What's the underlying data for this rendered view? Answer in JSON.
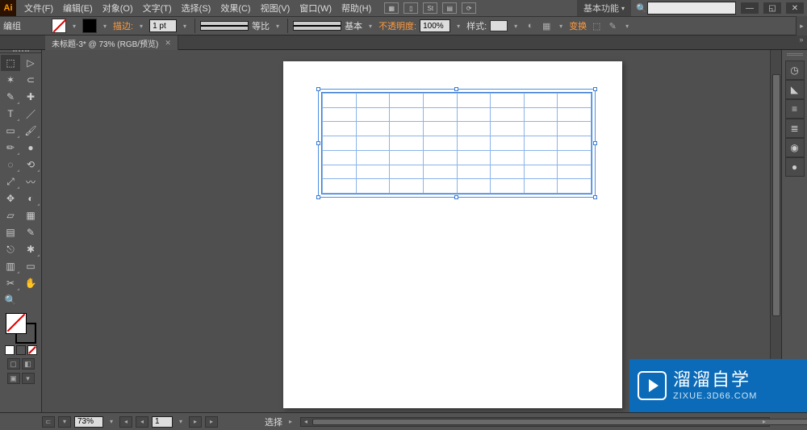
{
  "menubar": {
    "items": [
      "文件(F)",
      "编辑(E)",
      "对象(O)",
      "文字(T)",
      "选择(S)",
      "效果(C)",
      "视图(V)",
      "窗口(W)",
      "帮助(H)"
    ],
    "workspace_label": "基本功能",
    "search_placeholder": ""
  },
  "controlbar": {
    "context_label": "编组",
    "stroke_label": "描边:",
    "stroke_value": "1 pt",
    "dash_profile_label": "等比",
    "brush_label": "基本",
    "opacity_label": "不透明度:",
    "opacity_value": "100%",
    "style_label": "样式:",
    "transform_label": "变换"
  },
  "tabs": {
    "tab_title": "未标题-3* @ 73% (RGB/预览)"
  },
  "statusbar": {
    "zoom_value": "73%",
    "page_value": "1",
    "mode_label": "选择"
  },
  "tools": [
    [
      "selection",
      "direct-selection"
    ],
    [
      "magic-wand",
      "lasso"
    ],
    [
      "pen",
      "add-anchor"
    ],
    [
      "type",
      "line-segment"
    ],
    [
      "rectangle",
      "paintbrush"
    ],
    [
      "pencil",
      "blob-brush"
    ],
    [
      "eraser",
      "rotate"
    ],
    [
      "scale",
      "width"
    ],
    [
      "free-transform",
      "shape-builder"
    ],
    [
      "perspective",
      "mesh"
    ],
    [
      "gradient",
      "eyedropper"
    ],
    [
      "blend",
      "symbol-sprayer"
    ],
    [
      "column-graph",
      "artboard"
    ],
    [
      "slice",
      "hand"
    ],
    [
      "zoom",
      "empty"
    ]
  ],
  "tool_glyphs": [
    [
      "⬚",
      "▷"
    ],
    [
      "✶",
      "⊂"
    ],
    [
      "✎",
      "✚"
    ],
    [
      "T",
      "／"
    ],
    [
      "▭",
      "🖌"
    ],
    [
      "✏",
      "●"
    ],
    [
      "◌",
      "⟲"
    ],
    [
      "⤢",
      "〰"
    ],
    [
      "✥",
      "◐"
    ],
    [
      "▱",
      "▦"
    ],
    [
      "▤",
      "✎"
    ],
    [
      "⎋",
      "✱"
    ],
    [
      "▥",
      "▭"
    ],
    [
      "✂",
      "✋"
    ],
    [
      "🔍",
      " "
    ]
  ],
  "dock_icons": [
    "◷",
    "◣",
    "≡",
    "≣",
    "◉",
    "●"
  ],
  "grid": {
    "rows": 7,
    "cols": 8
  },
  "watermark": {
    "name_cn": "溜溜自学",
    "url": "ZIXUE.3D66.COM"
  }
}
